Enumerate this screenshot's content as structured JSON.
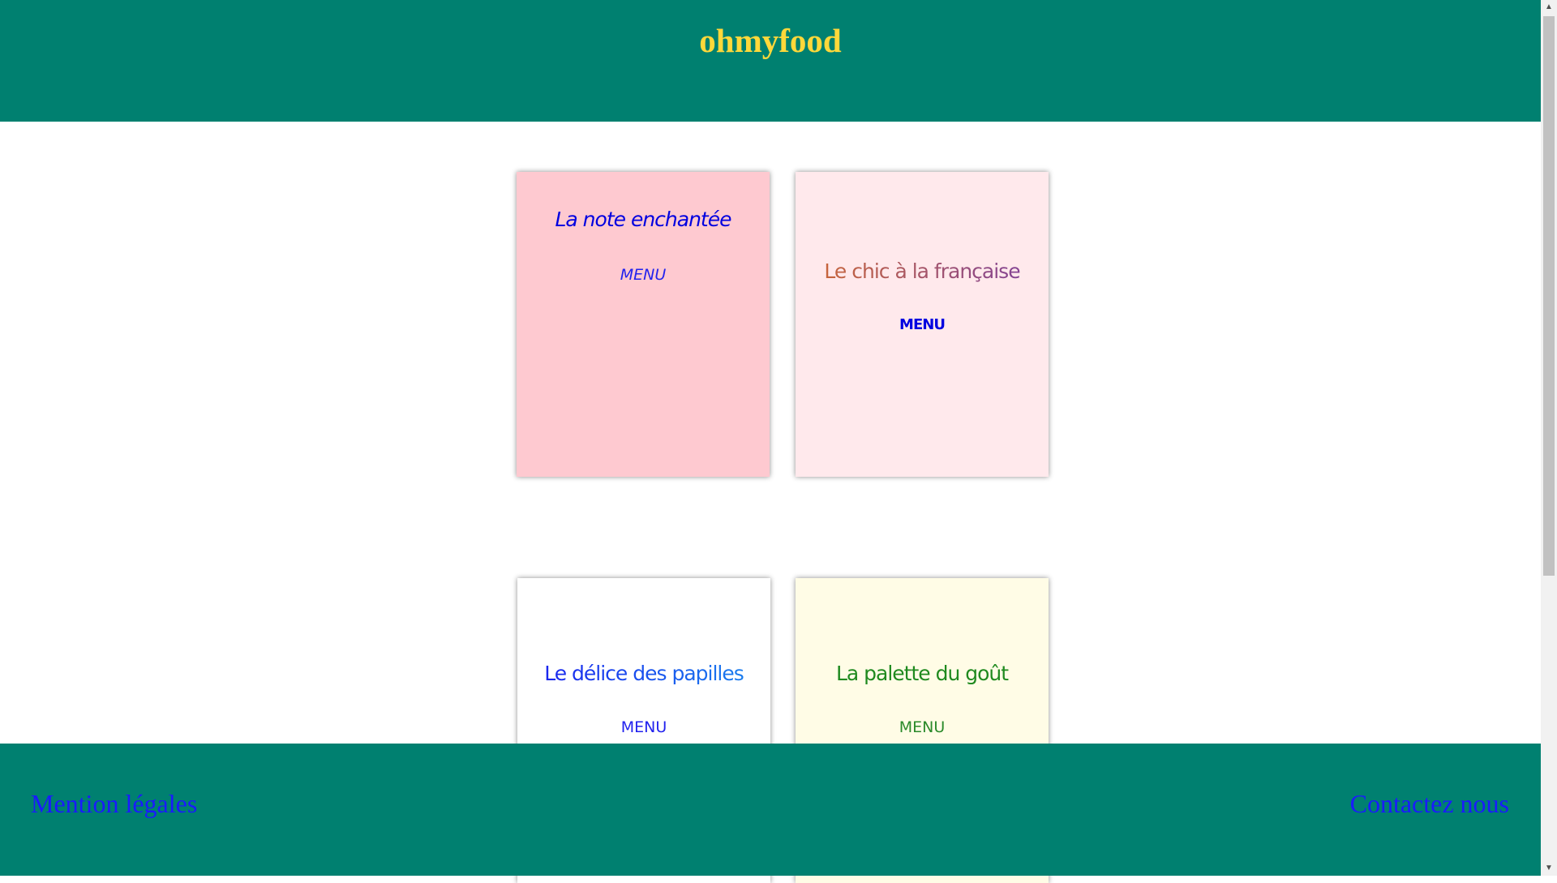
{
  "header": {
    "title": "ohmyfood"
  },
  "restaurants": [
    {
      "name": "La note enchantée",
      "menu_label": "MENU"
    },
    {
      "name": "Le chic à la française",
      "menu_label": "MENU"
    },
    {
      "name": "Le délice des papilles",
      "menu_label": "MENU"
    },
    {
      "name": "La palette du goût",
      "menu_label": "MENU"
    }
  ],
  "footer": {
    "left_link": "Mention légales",
    "right_link": "Contactez nous"
  },
  "colors": {
    "header_bg": "#008070",
    "title": "#ffd83a",
    "link": "#1a1aff"
  }
}
